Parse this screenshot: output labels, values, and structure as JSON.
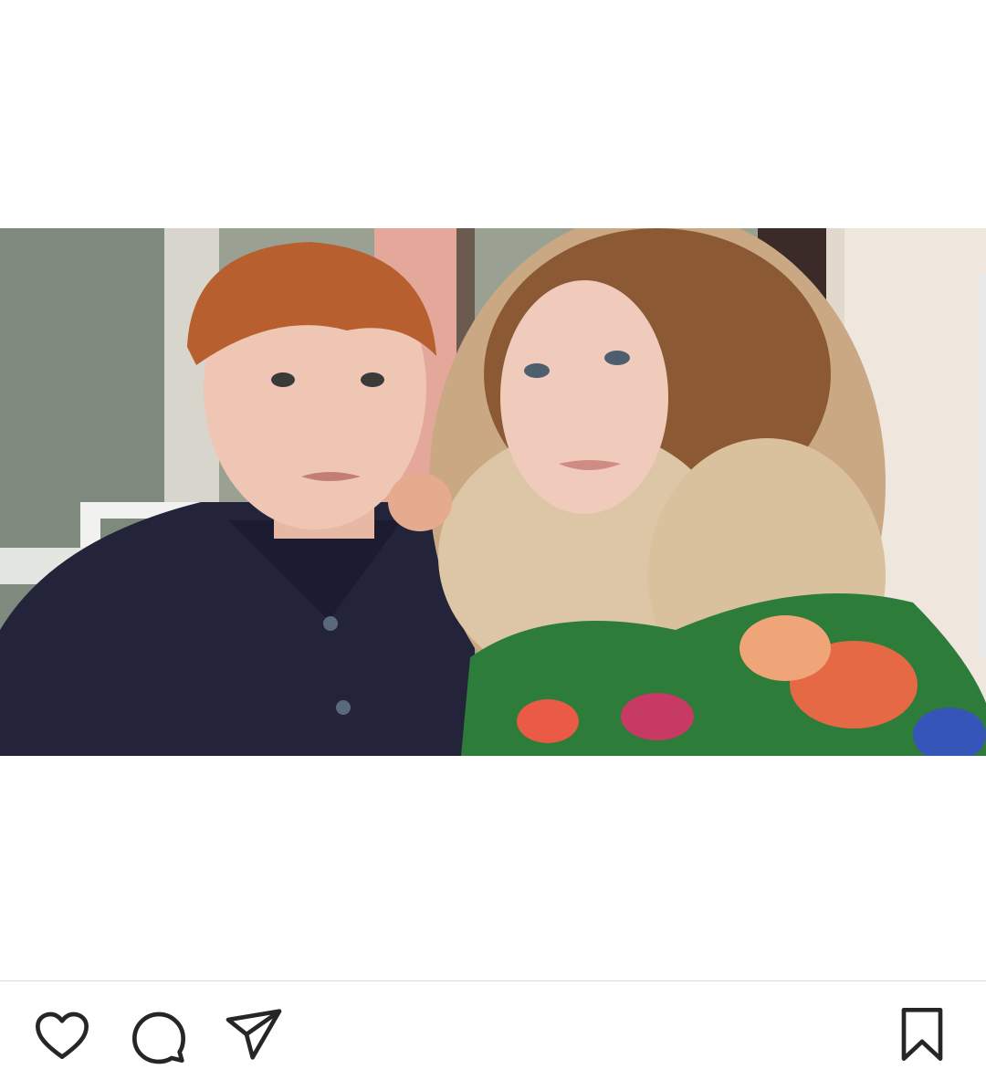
{
  "post": {
    "image": {
      "description_icon": "photo",
      "alt": ""
    }
  },
  "actions": {
    "like_icon": "heart-icon",
    "comment_icon": "speech-bubble-icon",
    "share_icon": "paper-plane-icon",
    "save_icon": "bookmark-icon"
  },
  "colors": {
    "background": "#ffffff",
    "icon_stroke": "#262626",
    "divider": "#dbdbdb"
  }
}
